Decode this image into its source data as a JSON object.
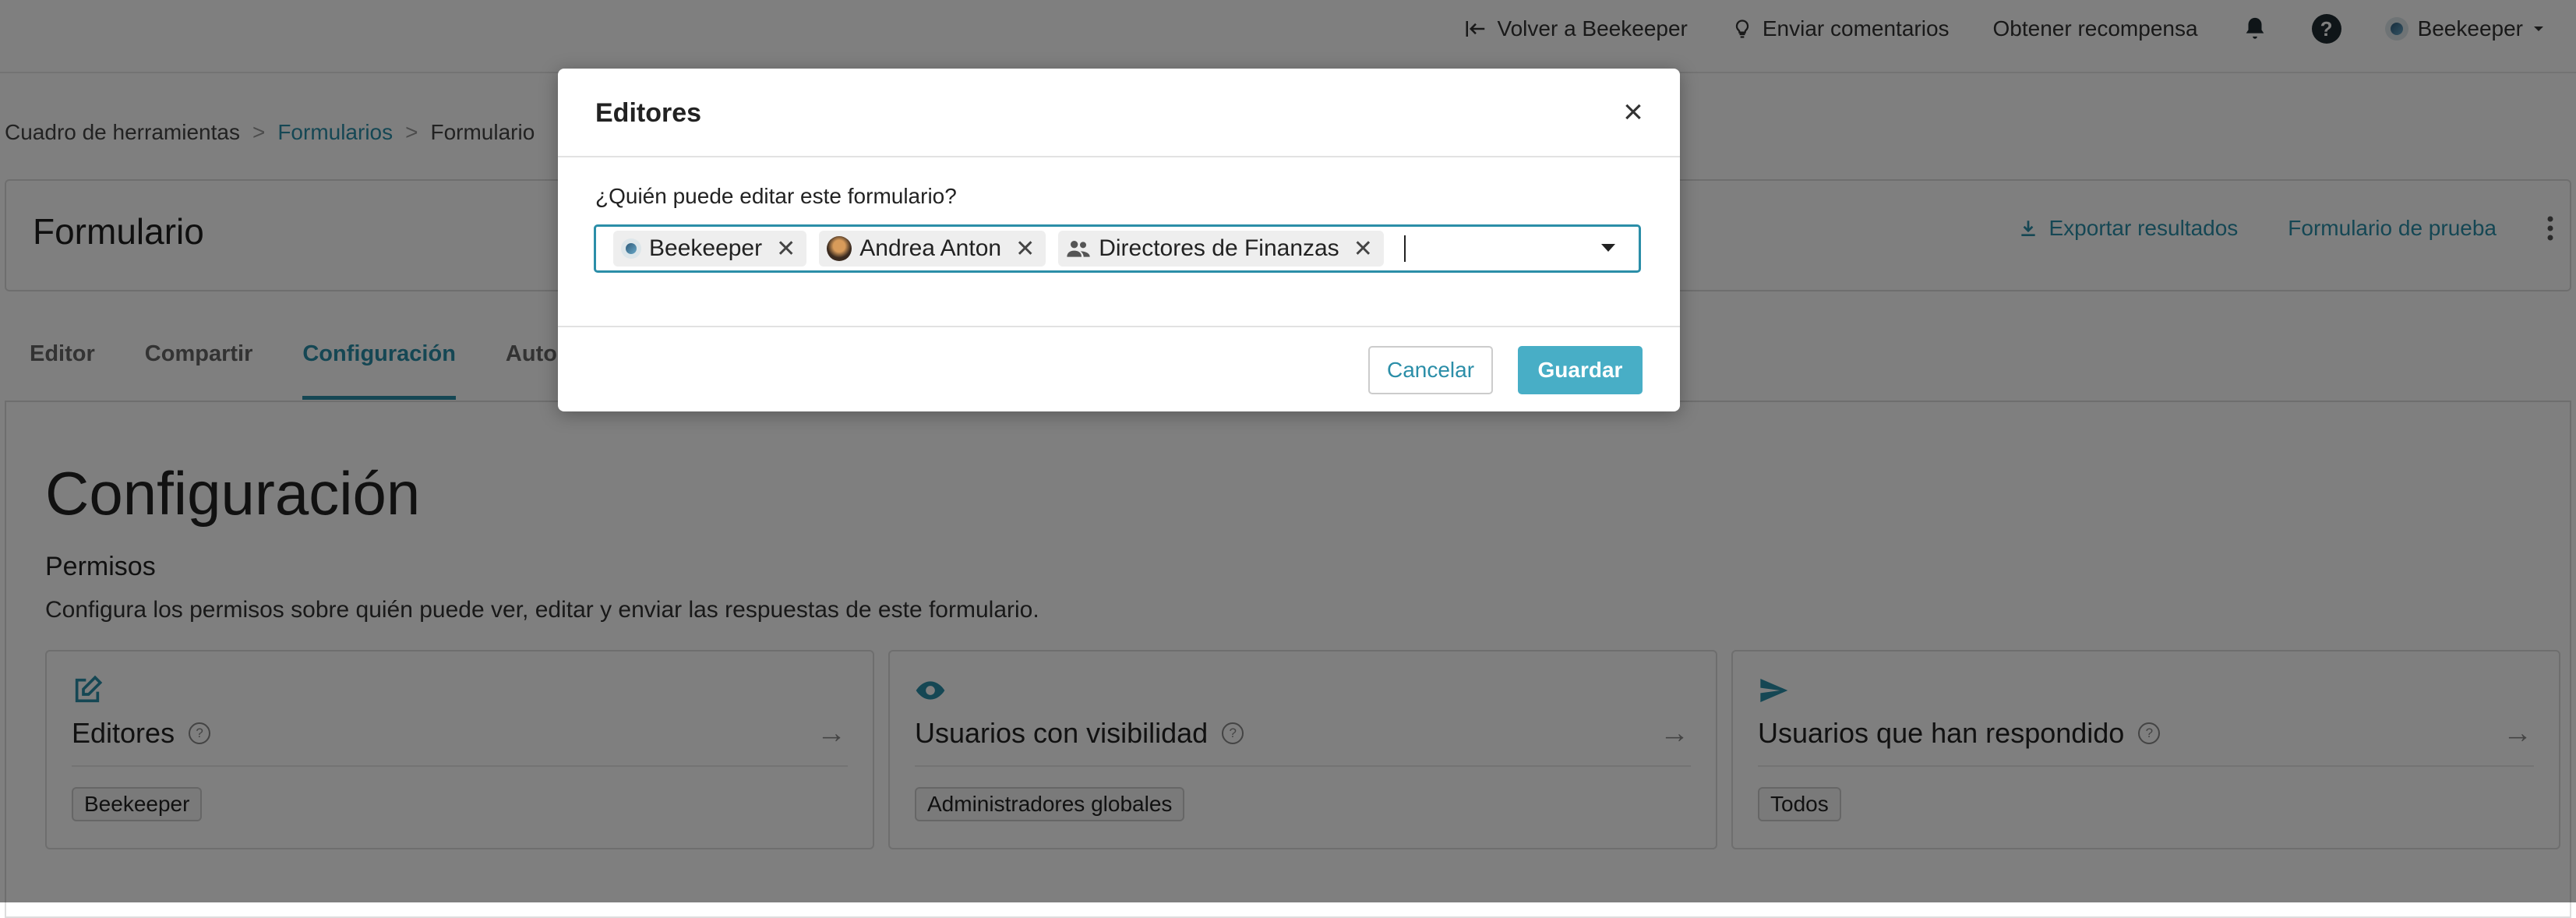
{
  "topnav": {
    "back_label": "Volver a Beekeeper",
    "feedback_label": "Enviar comentarios",
    "reward_label": "Obtener recompensa",
    "help_symbol": "?",
    "user_label": "Beekeeper",
    "icons": [
      "back-arrow-icon",
      "lightbulb-icon",
      "bell-icon",
      "help-icon",
      "chevron-down-icon"
    ]
  },
  "breadcrumb": {
    "items": [
      "Cuadro de herramientas",
      "Formularios",
      "Formulario"
    ],
    "separator": ">"
  },
  "header": {
    "title": "Formulario",
    "export_label": "Exportar resultados",
    "test_label": "Formulario de prueba",
    "more_icon": "more-vertical-icon"
  },
  "tabs": [
    {
      "label": "Editor"
    },
    {
      "label": "Compartir"
    },
    {
      "label": "Configuración",
      "active": true
    },
    {
      "label": "Automa"
    }
  ],
  "main": {
    "title": "Configuración",
    "permissions_title": "Permisos",
    "permissions_desc": "Configura los permisos sobre quién puede ver, editar y enviar las respuestas de este formulario.",
    "cards": [
      {
        "title": "Editores",
        "tag": "Beekeeper",
        "icon": "edit-icon"
      },
      {
        "title": "Usuarios con visibilidad",
        "tag": "Administradores globales",
        "icon": "eye-icon"
      },
      {
        "title": "Usuarios que han respondido",
        "tag": "Todos",
        "icon": "send-icon"
      }
    ],
    "help_symbol": "?",
    "arrow_symbol": "→"
  },
  "modal": {
    "title": "Editores",
    "close_symbol": "×",
    "field_label": "¿Quién puede editar este formulario?",
    "chips": [
      {
        "label": "Beekeeper",
        "icon": "beekeeper-logo-icon"
      },
      {
        "label": "Andrea Anton",
        "icon": "avatar"
      },
      {
        "label": "Directores de Finanzas",
        "icon": "group-icon"
      }
    ],
    "chip_remove_symbol": "✕",
    "cancel_label": "Cancelar",
    "save_label": "Guardar"
  },
  "colors": {
    "accent": "#2b8ea8",
    "save_button": "#48aec6",
    "overlay": "rgba(0,0,0,0.5)"
  }
}
